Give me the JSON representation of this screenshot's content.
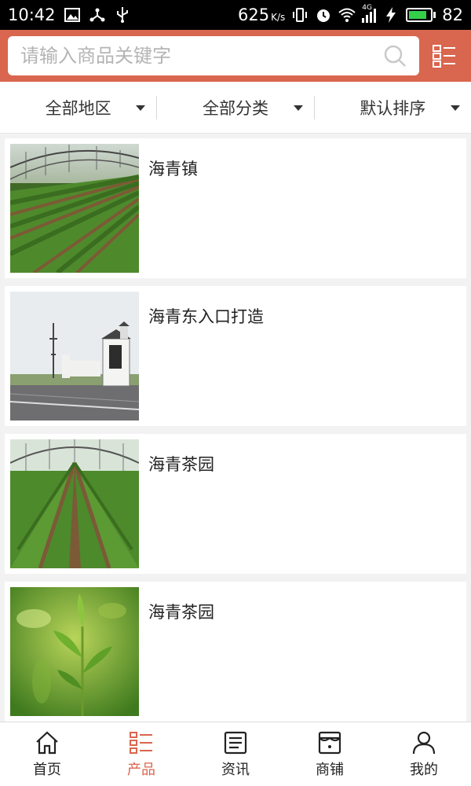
{
  "status_bar": {
    "time": "10:42",
    "net_speed": "625",
    "net_unit": "K/s",
    "signal_label": "4G",
    "battery_level": "82",
    "battery_percent": 82,
    "left_icons": [
      "image-icon",
      "share-icon",
      "usb-icon"
    ],
    "right_icons": [
      "vibrate-icon",
      "alarm-icon",
      "wifi-icon",
      "signal-icon",
      "charging-icon",
      "battery-icon"
    ]
  },
  "header": {
    "search_placeholder": "请输入商品关键字",
    "search_value": "",
    "accent_color": "#d9664e"
  },
  "filters": [
    {
      "label": "全部地区"
    },
    {
      "label": "全部分类"
    },
    {
      "label": "默认排序"
    }
  ],
  "products": [
    {
      "title": "海青镇",
      "image": "greenhouse-tea-rows"
    },
    {
      "title": "海青东入口打造",
      "image": "town-entrance-gate"
    },
    {
      "title": "海青茶园",
      "image": "greenhouse-tea-path"
    },
    {
      "title": "海青茶园",
      "image": "tea-sprout-closeup"
    }
  ],
  "bottom_nav": [
    {
      "label": "首页",
      "icon": "home-icon",
      "active": false
    },
    {
      "label": "产品",
      "icon": "list-icon",
      "active": true
    },
    {
      "label": "资讯",
      "icon": "news-icon",
      "active": false
    },
    {
      "label": "商铺",
      "icon": "shop-icon",
      "active": false
    },
    {
      "label": "我的",
      "icon": "user-icon",
      "active": false
    }
  ]
}
